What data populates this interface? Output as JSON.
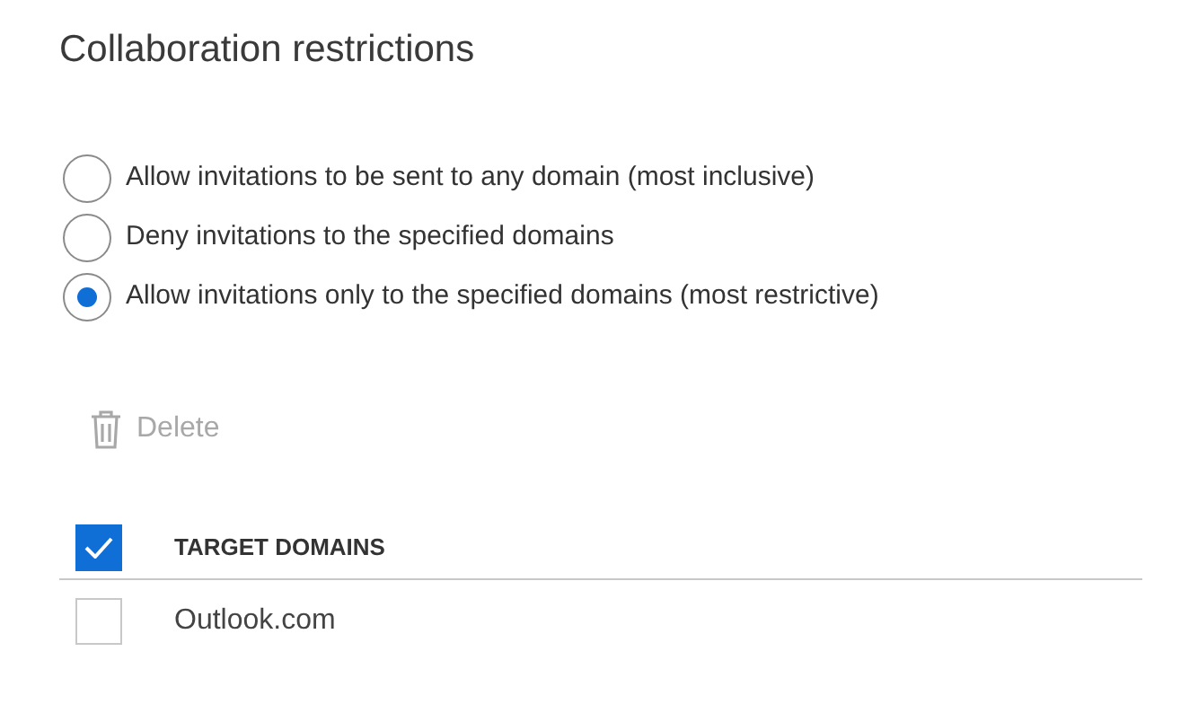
{
  "title": "Collaboration restrictions",
  "options": [
    {
      "label": "Allow invitations to be sent to any domain (most inclusive)",
      "selected": false
    },
    {
      "label": "Deny invitations to the specified domains",
      "selected": false
    },
    {
      "label": "Allow invitations only to the specified domains (most restrictive)",
      "selected": true
    }
  ],
  "delete_button": {
    "label": "Delete",
    "disabled": true
  },
  "table": {
    "header": {
      "label": "TARGET DOMAINS",
      "checked": true
    },
    "rows": [
      {
        "domain": "Outlook.com",
        "checked": false
      }
    ]
  }
}
